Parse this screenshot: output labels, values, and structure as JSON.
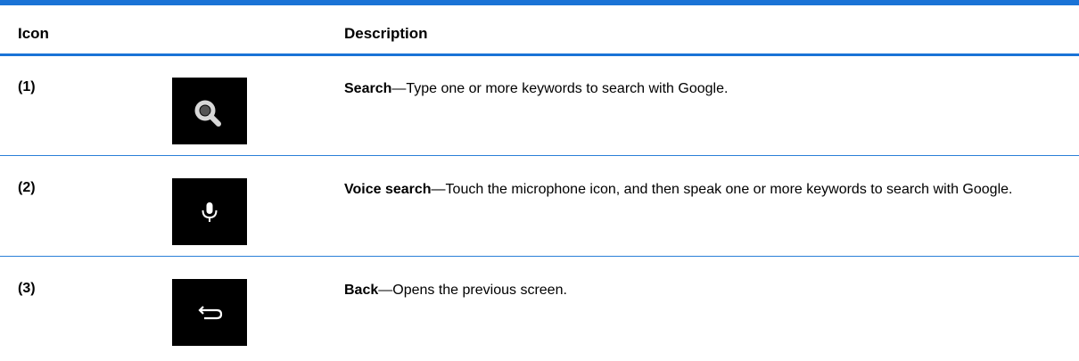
{
  "table": {
    "header": {
      "icon": "Icon",
      "description": "Description"
    },
    "rows": [
      {
        "number": "(1)",
        "icon": "search-icon",
        "term": "Search",
        "text": "—Type one or more keywords to search with Google."
      },
      {
        "number": "(2)",
        "icon": "microphone-icon",
        "term": "Voice search",
        "text": "—Touch the microphone icon, and then speak one or more keywords to search with Google."
      },
      {
        "number": "(3)",
        "icon": "back-arrow-icon",
        "term": "Back",
        "text": "—Opens the previous screen."
      }
    ]
  },
  "colors": {
    "rule": "#1a73d6",
    "icon_background": "#000000",
    "icon_foreground": "#ffffff"
  }
}
